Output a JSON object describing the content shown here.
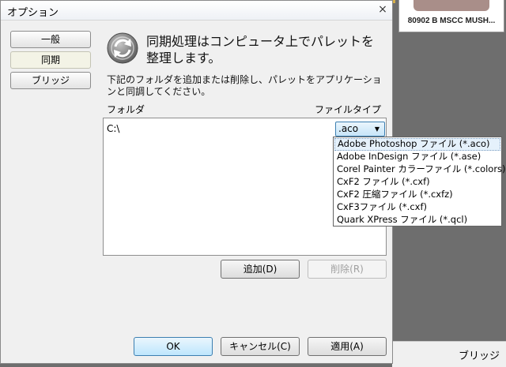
{
  "window": {
    "title": "オプション",
    "close_label": "×"
  },
  "nav": {
    "items": [
      {
        "label": "一般"
      },
      {
        "label": "同期"
      },
      {
        "label": "ブリッジ"
      }
    ]
  },
  "header": {
    "heading_line1": "同期処理はコンピュータ上でパレットを",
    "heading_line2": "整理します。",
    "description_line1": "下記のフォルダを追加または削除し、パレットをアプリケーショ",
    "description_line2": "ンと同調してください。"
  },
  "list": {
    "col_folder": "フォルダ",
    "col_filetype": "ファイルタイプ",
    "rows": [
      {
        "path": "C:\\",
        "filetype": ".aco"
      }
    ]
  },
  "dropdown": {
    "options": [
      "Adobe Photoshop ファイル (*.aco)",
      "Adobe InDesign ファイル (*.ase)",
      "Corel Painter カラーファイル (*.colors)",
      "CxF2 ファイル (*.cxf)",
      "CxF2 圧縮ファイル (*.cxfz)",
      "CxF3ファイル (*.cxf)",
      "Quark XPress ファイル (*.qcl)"
    ],
    "highlighted_index": 0
  },
  "actions": {
    "add_label": "追加(D)",
    "delete_label": "削除(R)",
    "ok_label": "OK",
    "cancel_label": "キャンセル(C)",
    "apply_label": "適用(A)"
  },
  "background": {
    "swatch_label": "80902 B MSCC MUSH...",
    "swatch_color": "#a98e89",
    "bottom_label": "ブリッジ"
  }
}
